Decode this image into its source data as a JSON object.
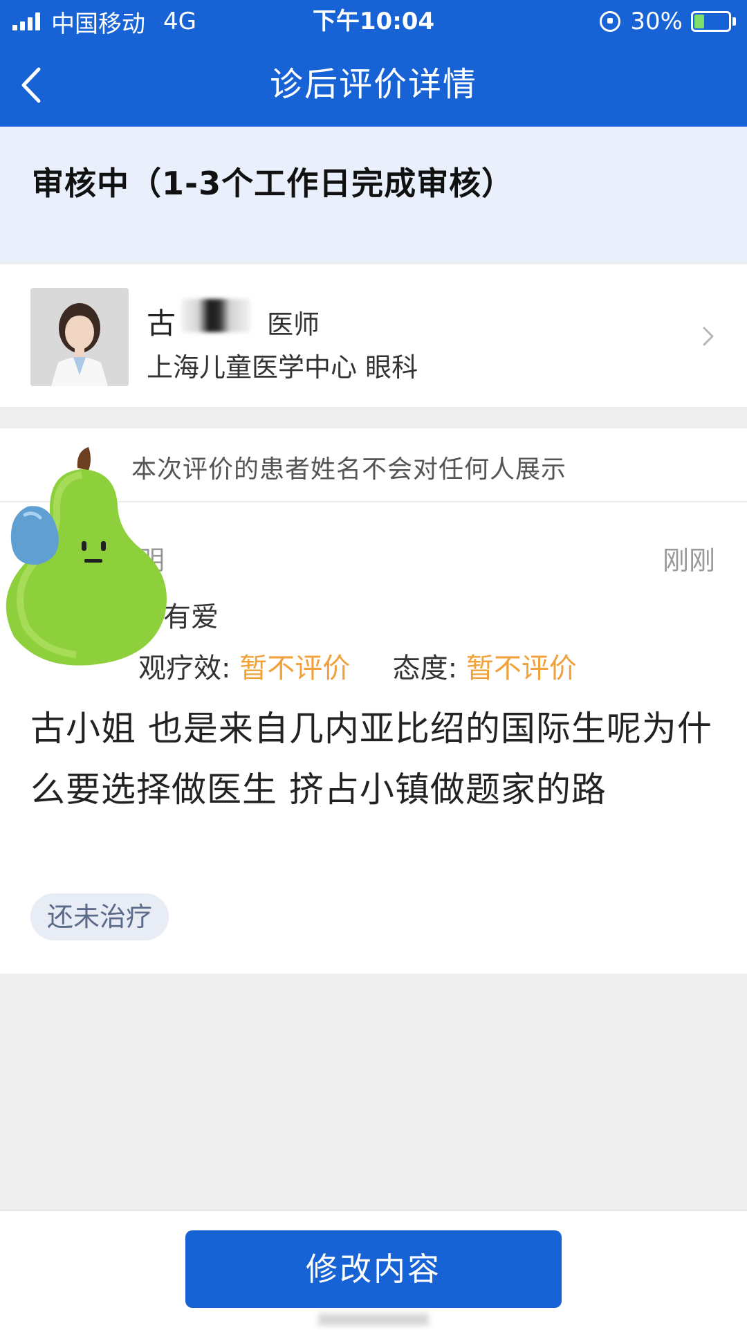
{
  "status_bar": {
    "carrier": "中国移动",
    "network": "4G",
    "time": "下午10:04",
    "battery": "30%",
    "battery_level": 0.3
  },
  "nav": {
    "title": "诊后评价详情"
  },
  "review_status": "审核中（1-3个工作日完成审核）",
  "doctor": {
    "name_visible": "古",
    "title": "医师",
    "hospital_dept": "上海儿童医学中心 眼科"
  },
  "review": {
    "privacy_note": "本次评价的患者姓名不会对任何人展示",
    "reviewer_name_partial": "明",
    "time": "刚刚",
    "overall_partial": "有爱",
    "efficacy_label_partial": "观疗效:",
    "efficacy_value": "暂不评价",
    "attitude_label": "态度:",
    "attitude_value": "暂不评价",
    "text": "古小姐 也是来自几内亚比绍的国际生呢为什么要选择做医生 挤占小镇做题家的路",
    "tag": "还未治疗"
  },
  "bottom": {
    "edit_button": "修改内容"
  },
  "colors": {
    "primary": "#1762d4",
    "rating_highlight": "#f0a13a",
    "status_panel": "#e9f0fb"
  }
}
